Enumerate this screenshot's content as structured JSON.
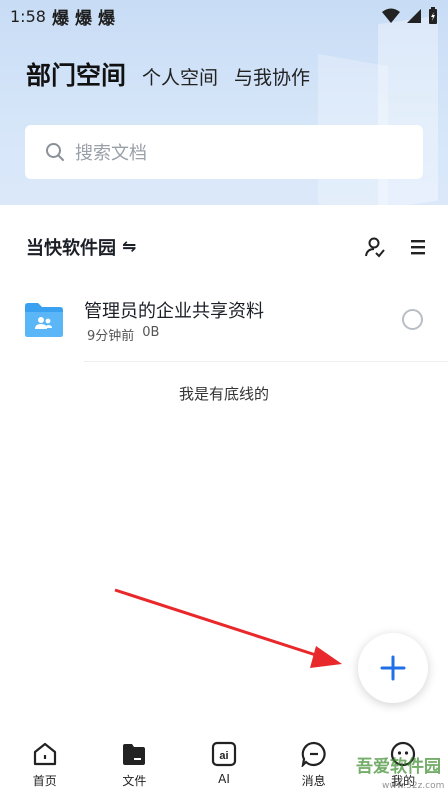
{
  "status_bar": {
    "time": "1:58",
    "notifications": [
      "爆",
      "爆",
      "爆"
    ]
  },
  "header": {
    "tabs": [
      {
        "label": "部门空间",
        "active": true
      },
      {
        "label": "个人空间",
        "active": false
      },
      {
        "label": "与我协作",
        "active": false
      }
    ]
  },
  "search": {
    "placeholder": "搜索文档"
  },
  "section": {
    "title": "当快软件园",
    "switch_icon": "switch-arrows-icon"
  },
  "files": [
    {
      "name": "管理员的企业共享资料",
      "time": "9分钟前",
      "size": "0B",
      "icon": "shared-folder-icon"
    }
  ],
  "footer_text": "我是有底线的",
  "bottom_nav": [
    {
      "label": "首页",
      "icon": "home-icon"
    },
    {
      "label": "文件",
      "icon": "file-folder-icon"
    },
    {
      "label": "AI",
      "icon": "ai-icon"
    },
    {
      "label": "消息",
      "icon": "message-icon"
    },
    {
      "label": "我的",
      "icon": "profile-icon"
    }
  ],
  "watermark": {
    "text": "吾爱软件园",
    "url": "www.52z.com"
  },
  "colors": {
    "accent": "#1f6fe8",
    "arrow": "#e8282b",
    "header_bg": "#d3e3f8"
  }
}
